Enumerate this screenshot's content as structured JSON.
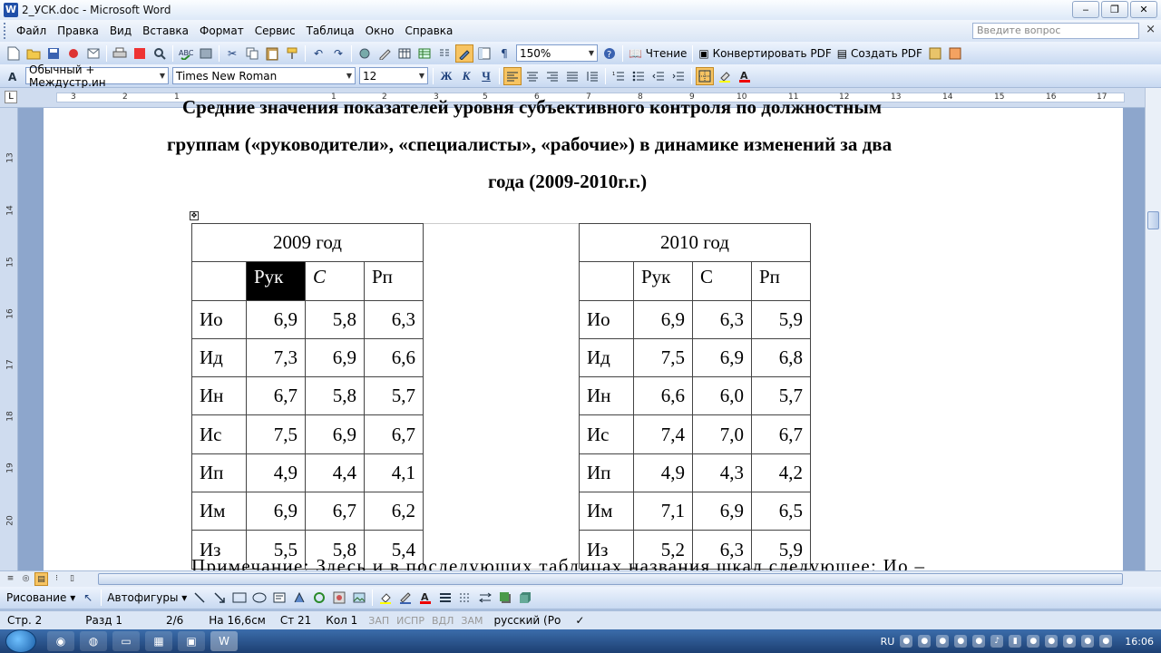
{
  "window": {
    "title": "2_УСК.doc - Microsoft Word",
    "app_icon": "W",
    "min": "‒",
    "max": "❐",
    "close": "✕"
  },
  "menu": {
    "items": [
      "Файл",
      "Правка",
      "Вид",
      "Вставка",
      "Формат",
      "Сервис",
      "Таблица",
      "Окно",
      "Справка"
    ],
    "ask_placeholder": "Введите вопрос",
    "close_glyph": "×"
  },
  "toolbar1": {
    "zoom": "150%",
    "reading_label": "Чтение",
    "convert_pdf": "Конвертировать PDF",
    "create_pdf": "Создать PDF",
    "pilcrow": "¶"
  },
  "toolbar2": {
    "style": "Обычный + Междустр.ин",
    "font": "Times New Roman",
    "size": "12",
    "bold": "Ж",
    "italic": "К",
    "underline": "Ч",
    "letter": "A"
  },
  "ruler": {
    "corner": "L",
    "h_numbers": [
      "3",
      "2",
      "1",
      "1",
      "2",
      "3",
      "4",
      "5",
      "6",
      "7",
      "8",
      "9",
      "10",
      "11",
      "12",
      "13",
      "14",
      "15",
      "16",
      "17"
    ],
    "v_numbers": [
      "13",
      "14",
      "15",
      "16",
      "17",
      "18",
      "19",
      "20"
    ]
  },
  "document": {
    "title_line1": "Средние значения показателей уровня субъективного контроля по должностным",
    "title_line2": "группам («руководители», «специалисты», «рабочие») в динамике изменений за два",
    "title_line3": "года (2009-2010г.г.)",
    "table": {
      "year1": "2009 год",
      "year2": "2010 год",
      "headers1": [
        "Рук",
        "С",
        "Рп"
      ],
      "headers2": [
        "Рук",
        "С",
        "Рп"
      ],
      "rows": [
        {
          "label": "Ио",
          "v2009": [
            "6,9",
            "5,8",
            "6,3"
          ],
          "label2": "Ио",
          "v2010": [
            "6,9",
            "6,3",
            "5,9"
          ]
        },
        {
          "label": "Ид",
          "v2009": [
            "7,3",
            "6,9",
            "6,6"
          ],
          "label2": "Ид",
          "v2010": [
            "7,5",
            "6,9",
            "6,8"
          ]
        },
        {
          "label": "Ин",
          "v2009": [
            "6,7",
            "5,8",
            "5,7"
          ],
          "label2": "Ин",
          "v2010": [
            "6,6",
            "6,0",
            "5,7"
          ]
        },
        {
          "label": "Ис",
          "v2009": [
            "7,5",
            "6,9",
            "6,7"
          ],
          "label2": "Ис",
          "v2010": [
            "7,4",
            "7,0",
            "6,7"
          ]
        },
        {
          "label": "Ип",
          "v2009": [
            "4,9",
            "4,4",
            "4,1"
          ],
          "label2": "Ип",
          "v2010": [
            "4,9",
            "4,3",
            "4,2"
          ]
        },
        {
          "label": "Им",
          "v2009": [
            "6,9",
            "6,7",
            "6,2"
          ],
          "label2": "Им",
          "v2010": [
            "7,1",
            "6,9",
            "6,5"
          ]
        },
        {
          "label": "Из",
          "v2009": [
            "5,5",
            "5,8",
            "5,4"
          ],
          "label2": "Из",
          "v2010": [
            "5,2",
            "6,3",
            "5,9"
          ]
        }
      ]
    },
    "note": "Примечание: Здесь и в последующих таблицах названия шкал следующее: Ио –"
  },
  "drawbar": {
    "drawing": "Рисование",
    "autoshapes": "Автофигуры"
  },
  "status": {
    "page": "Стр. 2",
    "section": "Разд 1",
    "pages": "2/6",
    "at": "На 16,6см",
    "line": "Ст 21",
    "col": "Кол 1",
    "rec": "ЗАП",
    "trk": "ИСПР",
    "ext": "ВДЛ",
    "ovr": "ЗАМ",
    "lang": "русский (Ро"
  },
  "taskbar": {
    "lang": "RU",
    "clock": "16:06"
  },
  "colors": {
    "accent": "#1f4fa8",
    "selection": "#f7c462"
  }
}
